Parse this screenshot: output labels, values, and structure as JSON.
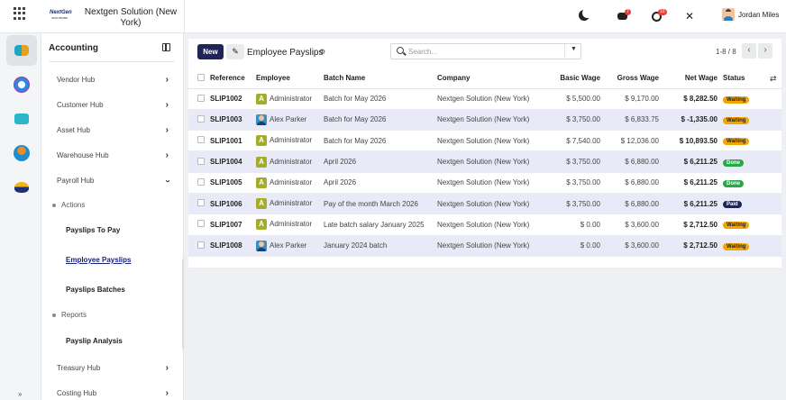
{
  "topbar": {
    "company_logo_text": "NextGen",
    "company_logo_sub": "SOLUTIONS",
    "company_name": "Nextgen Solution (New York)",
    "chat_badge": "7",
    "activity_badge": "10",
    "user_name": "Jordan Miles"
  },
  "sidebar": {
    "title": "Accounting",
    "hubs": [
      {
        "label": "Vendor Hub"
      },
      {
        "label": "Customer Hub"
      },
      {
        "label": "Asset Hub"
      },
      {
        "label": "Warehouse Hub"
      },
      {
        "label": "Payroll Hub"
      }
    ],
    "actions_label": "Actions",
    "links": [
      "Payslips To Pay",
      "Employee Payslips",
      "Payslips Batches"
    ],
    "reports_label": "Reports",
    "report_links": [
      "Payslip Analysis"
    ],
    "bottom_hubs": [
      "Treasury Hub",
      "Costing Hub"
    ]
  },
  "toolbar": {
    "new_label": "New",
    "view_title": "Employee Payslips",
    "search_placeholder": "Search...",
    "pager": "1-8 / 8"
  },
  "table": {
    "headers": {
      "reference": "Reference",
      "employee": "Employee",
      "batch": "Batch Name",
      "company": "Company",
      "basic": "Basic Wage",
      "gross": "Gross Wage",
      "net": "Net Wage",
      "status": "Status"
    },
    "rows": [
      {
        "ref": "SLIP1002",
        "emp": "Administrator",
        "av": "admin",
        "batch": "Batch for May 2026",
        "company": "Nextgen Solution (New York)",
        "basic": "$ 5,500.00",
        "gross": "$ 9,170.00",
        "net": "$ 8,282.50",
        "status": "Waiting",
        "st": "waiting"
      },
      {
        "ref": "SLIP1003",
        "emp": "Alex Parker",
        "av": "photo",
        "batch": "Batch for May 2026",
        "company": "Nextgen Solution (New York)",
        "basic": "$ 3,750.00",
        "gross": "$ 6,833.75",
        "net": "$ -1,335.00",
        "status": "Waiting",
        "st": "waiting"
      },
      {
        "ref": "SLIP1001",
        "emp": "Administrator",
        "av": "admin",
        "batch": "Batch for May 2026",
        "company": "Nextgen Solution (New York)",
        "basic": "$ 7,540.00",
        "gross": "$ 12,036.00",
        "net": "$ 10,893.50",
        "status": "Waiting",
        "st": "waiting"
      },
      {
        "ref": "SLIP1004",
        "emp": "Administrator",
        "av": "admin",
        "batch": "April 2026",
        "company": "Nextgen Solution (New York)",
        "basic": "$ 3,750.00",
        "gross": "$ 6,880.00",
        "net": "$ 6,211.25",
        "status": "Done",
        "st": "done"
      },
      {
        "ref": "SLIP1005",
        "emp": "Administrator",
        "av": "admin",
        "batch": "April 2026",
        "company": "Nextgen Solution (New York)",
        "basic": "$ 3,750.00",
        "gross": "$ 6,880.00",
        "net": "$ 6,211.25",
        "status": "Done",
        "st": "done"
      },
      {
        "ref": "SLIP1006",
        "emp": "Administrator",
        "av": "admin",
        "batch": "Pay of the month March 2026",
        "company": "Nextgen Solution (New York)",
        "basic": "$ 3,750.00",
        "gross": "$ 6,880.00",
        "net": "$ 6,211.25",
        "status": "Paid",
        "st": "paid"
      },
      {
        "ref": "SLIP1007",
        "emp": "Administrator",
        "av": "admin",
        "batch": "Late batch salary January 2025",
        "company": "Nextgen Solution (New York)",
        "basic": "$ 0.00",
        "gross": "$ 3,600.00",
        "net": "$ 2,712.50",
        "status": "Waiting",
        "st": "waiting"
      },
      {
        "ref": "SLIP1008",
        "emp": "Alex Parker",
        "av": "photo",
        "batch": "January 2024 batch",
        "company": "Nextgen Solution (New York)",
        "basic": "$ 0.00",
        "gross": "$ 3,600.00",
        "net": "$ 2,712.50",
        "status": "Waiting",
        "st": "waiting"
      }
    ]
  }
}
